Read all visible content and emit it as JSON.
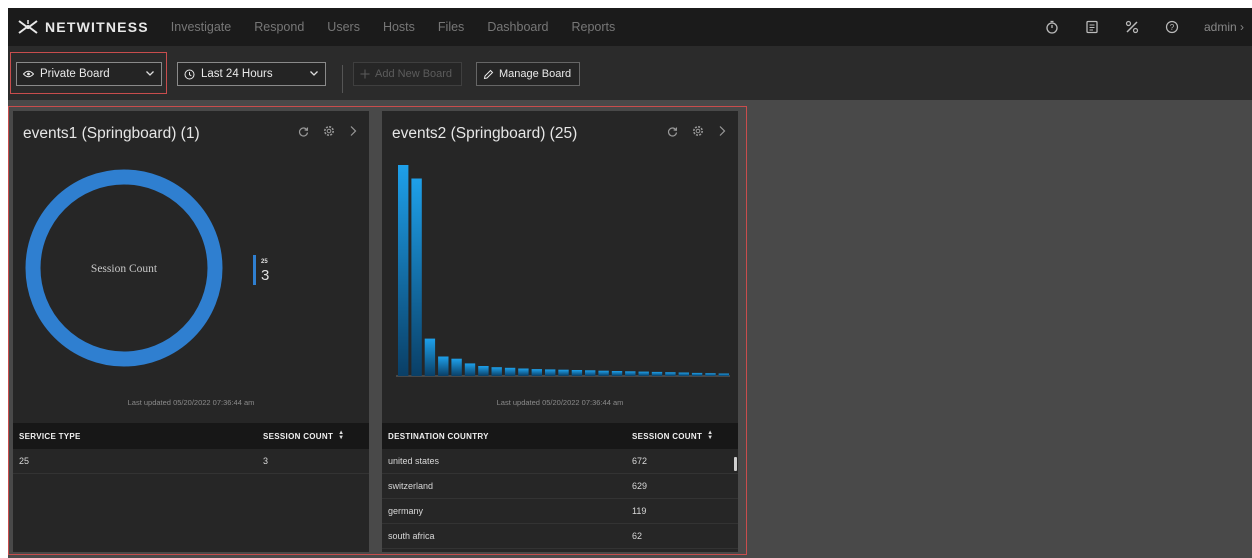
{
  "app": {
    "brand": "NETWITNESS"
  },
  "nav": {
    "items": [
      "Investigate",
      "Respond",
      "Users",
      "Hosts",
      "Files",
      "Dashboard",
      "Reports"
    ],
    "user": "admin"
  },
  "toolbar": {
    "board_select": "Private Board",
    "time_select": "Last 24 Hours",
    "add_new_board": "Add New Board",
    "manage_board": "Manage Board"
  },
  "dashlets": [
    {
      "title": "events1 (Springboard) (1)",
      "updated": "Last updated 05/20/2022 07:36:44 am",
      "chart_data": {
        "type": "pie",
        "center_label": "Session Count",
        "legend": [
          {
            "label": "25",
            "value": "3"
          }
        ],
        "categories": [
          "25"
        ],
        "values": [
          3
        ]
      },
      "columns": [
        "SERVICE TYPE",
        "SESSION COUNT"
      ],
      "rows": [
        [
          "25",
          "3"
        ]
      ]
    },
    {
      "title": "events2 (Springboard) (25)",
      "updated": "Last updated 05/20/2022 07:36:44 am",
      "chart_data": {
        "type": "bar",
        "values": [
          672,
          629,
          119,
          62,
          55,
          40,
          32,
          28,
          26,
          24,
          22,
          21,
          20,
          19,
          18,
          17,
          16,
          15,
          14,
          13,
          12,
          11,
          10,
          9,
          8
        ]
      },
      "columns": [
        "DESTINATION COUNTRY",
        "SESSION COUNT"
      ],
      "rows": [
        [
          "united states",
          "672"
        ],
        [
          "switzerland",
          "629"
        ],
        [
          "germany",
          "119"
        ],
        [
          "south africa",
          "62"
        ]
      ]
    }
  ],
  "colors": {
    "accent": "#2f7fd0",
    "highlight_border": "#c84d4d"
  }
}
